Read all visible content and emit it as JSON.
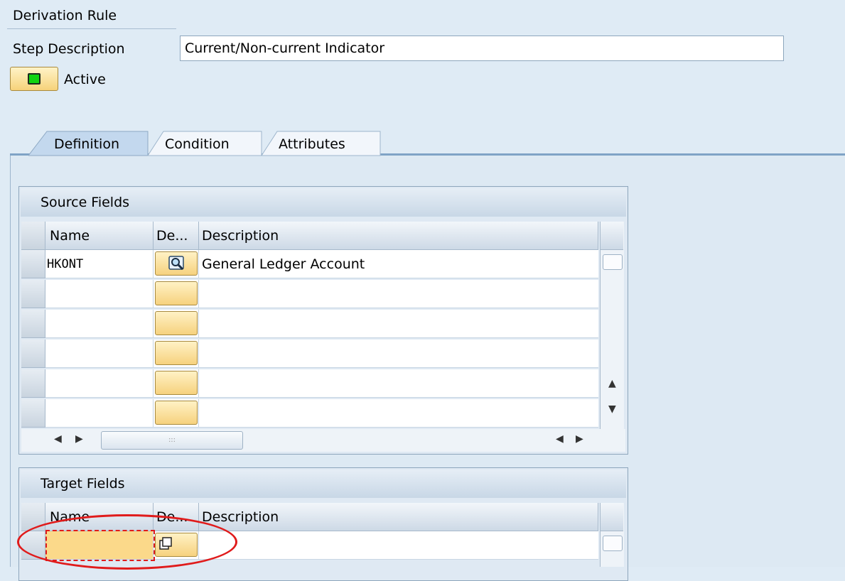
{
  "header": {
    "rule_label": "Derivation Rule",
    "step_label": "Step Description",
    "step_value": "Current/Non-current Indicator",
    "active_label": "Active",
    "active_color": "#11d411"
  },
  "tabs": [
    {
      "label": "Definition",
      "active": true
    },
    {
      "label": "Condition",
      "active": false
    },
    {
      "label": "Attributes",
      "active": false
    }
  ],
  "source": {
    "title": "Source Fields",
    "columns": [
      "Name",
      "De...",
      "Description"
    ],
    "rows": [
      {
        "name": "HKONT",
        "description": "General Ledger Account",
        "de_icon": "search-help-icon"
      },
      {
        "name": "",
        "description": ""
      },
      {
        "name": "",
        "description": ""
      },
      {
        "name": "",
        "description": ""
      },
      {
        "name": "",
        "description": ""
      },
      {
        "name": "",
        "description": ""
      }
    ]
  },
  "target": {
    "title": "Target Fields",
    "columns": [
      "Name",
      "De...",
      "Description"
    ],
    "rows": [
      {
        "name": "",
        "description": "",
        "de_icon": "copy-icon"
      }
    ]
  },
  "colors": {
    "background": "#dfebf5",
    "button_yellow": "#f6d27a",
    "highlight": "#e01b1b"
  }
}
